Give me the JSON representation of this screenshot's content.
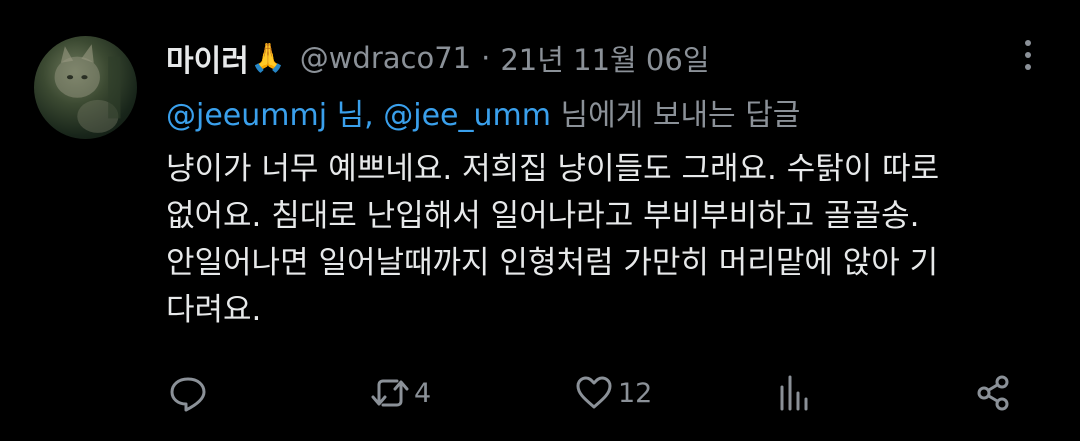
{
  "tweet": {
    "display_name": "마이러",
    "name_emoji": "🙏",
    "handle": "@wdraco71",
    "separator": "·",
    "date": "21년 11월 06일",
    "reply_to": {
      "mention1": "@jeeummj",
      "mention1_suffix": " 님, ",
      "mention2": "@jee_umm",
      "trailing_text": " 님에게 보내는 답글"
    },
    "body_lines": [
      "냥이가 너무 예쁘네요. 저희집 냥이들도 그래요. 수탉이 따로",
      "없어요. 침대로 난입해서 일어나라고 부비부비하고 골골송.",
      "안일어나면 일어날때까지 인형처럼 가만히 머리맡에 앉아 기",
      "다려요."
    ],
    "actions": {
      "reply_icon": "reply-icon",
      "retweet_icon": "retweet-icon",
      "retweet_count": "4",
      "like_icon": "heart-icon",
      "like_count": "12",
      "views_icon": "views-icon",
      "share_icon": "share-icon"
    },
    "colors": {
      "background": "#000000",
      "primary_text": "#e7e9ea",
      "secondary_text": "#8b9198",
      "mention": "#3aa0ec"
    }
  }
}
